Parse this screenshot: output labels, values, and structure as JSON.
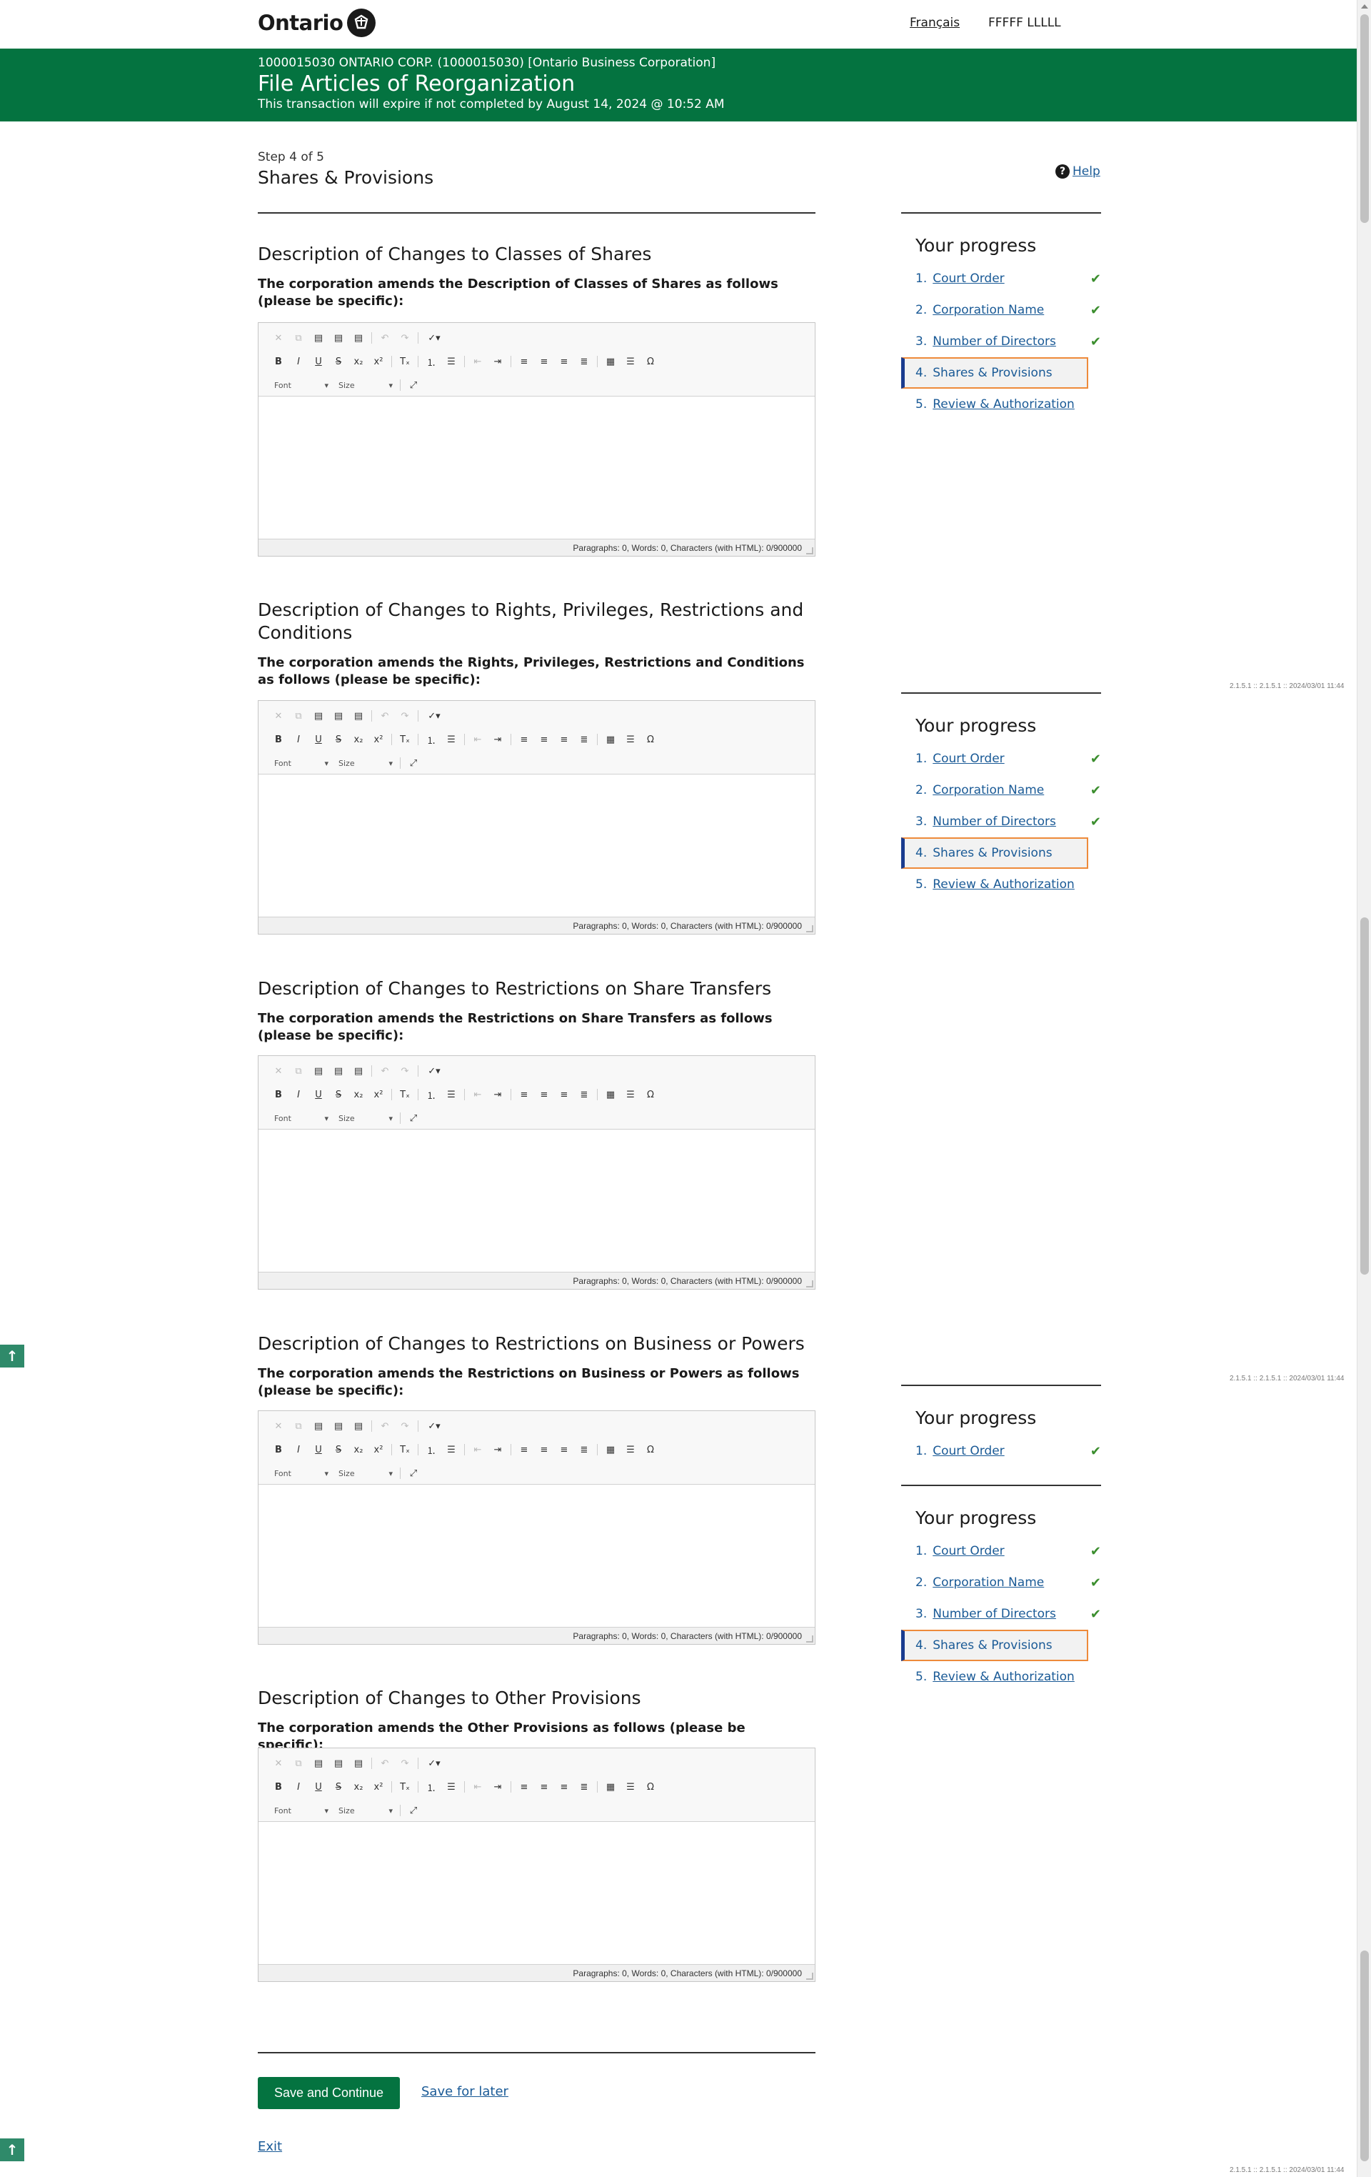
{
  "header": {
    "logo_text": "Ontario",
    "lang_link": "Français",
    "user_name": "FFFFF LLLLL"
  },
  "banner": {
    "corporation": "1000015030 ONTARIO CORP. (1000015030) [Ontario Business Corporation]",
    "title": "File Articles of Reorganization",
    "expiry": "This transaction will expire if not completed by August 14, 2024 @ 10:52 AM"
  },
  "step": {
    "label": "Step 4 of 5",
    "title": "Shares & Provisions",
    "help": "Help"
  },
  "sections": [
    {
      "heading": "Description of Changes to Classes of Shares",
      "instruction": "The corporation amends the Description of Classes of Shares as follows (please be specific):"
    },
    {
      "heading": "Description of Changes to Rights, Privileges, Restrictions and Conditions",
      "instruction": "The corporation amends the Rights, Privileges, Restrictions and Conditions as follows (please be specific):"
    },
    {
      "heading": "Description of Changes to Restrictions on Share Transfers",
      "instruction": "The corporation amends the Restrictions on Share Transfers as follows (please be specific):"
    },
    {
      "heading": "Description of Changes to Restrictions on Business or Powers",
      "instruction": "The corporation amends the Restrictions on Business or Powers as follows (please be specific):"
    },
    {
      "heading": "Description of Changes to Other Provisions",
      "instruction": "The corporation amends the Other Provisions as follows (please be specific):"
    }
  ],
  "editor": {
    "font_label": "Font",
    "size_label": "Size",
    "status": "Paragraphs: 0, Words: 0, Characters (with HTML): 0/900000",
    "bold": "B",
    "italic": "I",
    "underline": "U",
    "strike": "S",
    "subscript": "x₂",
    "superscript": "x²",
    "clear": "Tₓ",
    "omega": "Ω"
  },
  "progress": {
    "title": "Your progress",
    "steps": [
      {
        "num": "1.",
        "label": "Court Order"
      },
      {
        "num": "2.",
        "label": "Corporation Name"
      },
      {
        "num": "3.",
        "label": "Number of Directors"
      },
      {
        "num": "4.",
        "label": "Shares & Provisions"
      },
      {
        "num": "5.",
        "label": "Review & Authorization"
      }
    ]
  },
  "version": "2.1.5.1 :: 2.1.5.1 :: 2024/03/01 11:44",
  "actions": {
    "save_continue": "Save and Continue",
    "save_later": "Save for later",
    "exit": "Exit"
  },
  "colors": {
    "brand_green": "#047340",
    "link_blue": "#1a5a96",
    "check_green": "#3b8e2e",
    "current_border": "#ee8a3a"
  }
}
